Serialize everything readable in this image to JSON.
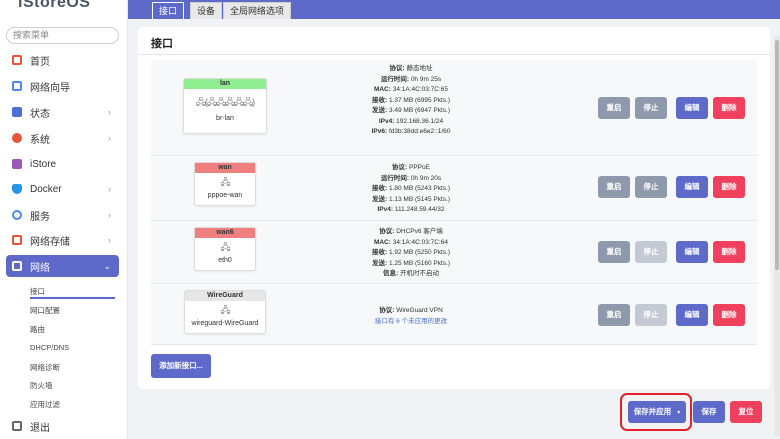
{
  "app": {
    "logo": "iStoreOS"
  },
  "sidebar": {
    "search_placeholder": "搜索菜单",
    "items": [
      {
        "label": "首页",
        "icon": "home-icon",
        "color": "#e8553a"
      },
      {
        "label": "网络向导",
        "icon": "wizard-icon",
        "color": "#4a8af4"
      },
      {
        "label": "状态",
        "icon": "status-icon",
        "color": "#4a6fd0"
      },
      {
        "label": "系统",
        "icon": "gear-icon",
        "color": "#e8553a"
      },
      {
        "label": "iStore",
        "icon": "store-icon",
        "color": "#9b59b6"
      },
      {
        "label": "Docker",
        "icon": "docker-icon",
        "color": "#2496ed"
      },
      {
        "label": "服务",
        "icon": "services-icon",
        "color": "#4a8af4"
      },
      {
        "label": "网络存储",
        "icon": "storage-icon",
        "color": "#e8553a"
      },
      {
        "label": "网络",
        "icon": "network-icon",
        "color": "#ffffff"
      },
      {
        "label": "退出",
        "icon": "logout-icon",
        "color": "#666666"
      }
    ],
    "network_subitems": [
      "接口",
      "网口配置",
      "路由",
      "DHCP/DNS",
      "网络诊断",
      "防火墙",
      "应用过滤"
    ]
  },
  "tabs": [
    "接口",
    "设备",
    "全局网络选项"
  ],
  "page": {
    "title": "接口",
    "add_button": "添加新接口...",
    "save_apply": "保存并应用",
    "save_apply_caret": "▾",
    "save": "保存",
    "reset": "复位"
  },
  "buttons": {
    "restart": "重启",
    "stop": "停止",
    "edit": "编辑",
    "delete": "删除"
  },
  "interfaces": [
    {
      "name": "lan",
      "header_color": "#90ee90",
      "device": "br-lan",
      "icons": "🖧(🖧🖧🖧🖧🖧)",
      "info": [
        [
          "协议:",
          "静态地址"
        ],
        [
          "运行时间:",
          "0h 9m 25s"
        ],
        [
          "MAC:",
          "34:1A:4C:03:7C:65"
        ],
        [
          "接收:",
          "1.37 MB (6995 Pkts.)"
        ],
        [
          "发送:",
          "3.49 MB (6947 Pkts.)"
        ],
        [
          "IPv4:",
          "192.168.36.1/24"
        ],
        [
          "IPv6:",
          "fd3b:38dd:e6e2::1/60"
        ]
      ]
    },
    {
      "name": "wan",
      "header_color": "#f08080",
      "device": "pppoe-wan",
      "icons": "🖧",
      "info": [
        [
          "协议:",
          "PPPoE"
        ],
        [
          "运行时间:",
          "0h 9m 20s"
        ],
        [
          "接收:",
          "1.80 MB (5243 Pkts.)"
        ],
        [
          "发送:",
          "1.13 MB (5145 Pkts.)"
        ],
        [
          "IPv4:",
          "111.248.59.44/32"
        ]
      ]
    },
    {
      "name": "wan6",
      "header_color": "#f08080",
      "device": "eth0",
      "icons": "🖧",
      "info": [
        [
          "协议:",
          "DHCPv6 客户端"
        ],
        [
          "MAC:",
          "34:1A:4C:03:7C:64"
        ],
        [
          "接收:",
          "1.92 MB (5250 Pkts.)"
        ],
        [
          "发送:",
          "1.25 MB (5160 Pkts.)"
        ],
        [
          "信息:",
          "开机时不启动"
        ]
      ]
    },
    {
      "name": "WireGuard",
      "header_color": "#e6e6e6",
      "device": "wireguard-WireGuard",
      "icons": "🖧",
      "info": [
        [
          "协议:",
          "WireGuard VPN"
        ]
      ],
      "pending": "接口有 6 个未应用的更改"
    }
  ]
}
